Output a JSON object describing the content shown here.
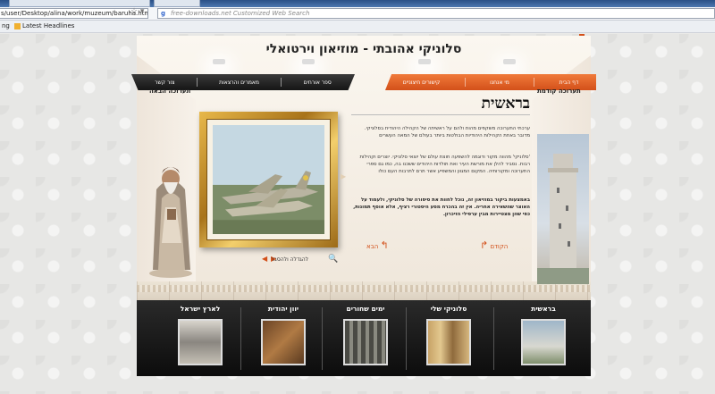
{
  "browser": {
    "url": "s/user/Desktop/alina/work/muzeum/baruha.html",
    "search_placeholder": "free-downloads.net Customized Web Search",
    "search_engine_glyph": "g",
    "bookmarks": [
      {
        "label": "ng"
      },
      {
        "label": "Latest Headlines"
      }
    ]
  },
  "museum": {
    "title": "סלוניקי אהובתי - מוזיאון וירטואלי",
    "nav_right": [
      "דף הבית",
      "מי אנחנו",
      "קישורים חיצוניים"
    ],
    "nav_left": [
      "ספר אורחים",
      "מאמרים והרצאות",
      "צור קשר"
    ],
    "prev_exhibit": "תערוכה קודמת",
    "next_exhibit": "תערוכה הבאה",
    "heading": "בראשית",
    "paragraphs": [
      "ערכתי התערוכה משקפים מהות ולהם על ראשיתה של הקהילה היהודית בסלוניקי. מדובר באחת הקהילות היהודיות הבולטות ביותר בעולם של המאה העשרים",
      "'סלוניקי' מהווה מקור ודוגמה להשפעה חוצת עולם של יוצאי סלוניקי. יוצרים וקהילות רבות. נסביר להלן את מורשת העיר ואת תולדות היהודים ששכנו בה, כמו גם ספרי התערוכה ומקורותיה. המקום המגוון והמשפיע אשר תרם לתרבות העם כולו",
      "באמצעות ביקור במוזיאון זה, נוכל לחוות את סיפורה של סלוניקי, ולעמוד על האוצר שהשאירה אחריה. אין זה בהכרח מסע היסטורי רציף, אלא אוסף תמונות, כפי שהן מצטיירות מבין ערפילי הזיכרון."
    ],
    "link_back": "הקודם",
    "link_next": "הבא",
    "frame_caption": "להגדלה ולהסבר",
    "arrows": [
      "◀",
      "▶"
    ],
    "bottom_tabs": [
      {
        "label": "בראשית"
      },
      {
        "label": "סלוניקי שלי"
      },
      {
        "label": "ימים שחורים"
      },
      {
        "label": "יוון יהודית"
      },
      {
        "label": "לארץ ישראל"
      }
    ],
    "colors": {
      "accent": "#d3501a",
      "dark": "#151515",
      "gold": "#d4a03c"
    },
    "icons": [
      "zoom-icon",
      "arrow-left-icon",
      "arrow-right-icon",
      "star-icon"
    ]
  }
}
